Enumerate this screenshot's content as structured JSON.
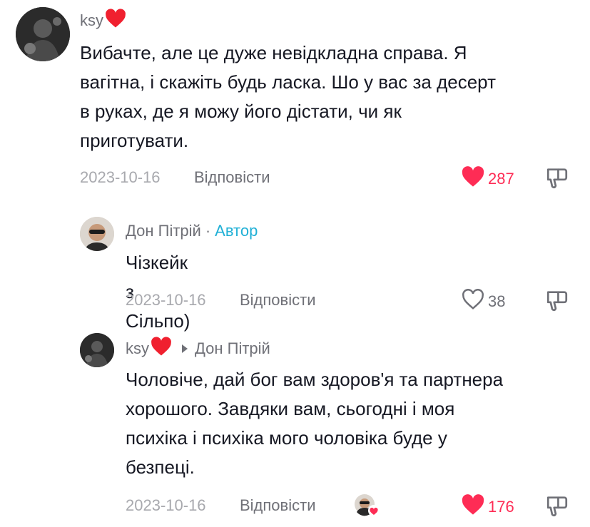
{
  "comments": [
    {
      "author": "ksy",
      "text": "Вибачте, але це дуже невідкладна справа. Я вагітна, і скажіть будь ласка. Шо у вас за десерт в руках, де я можу його дістати, чи як приготувати.",
      "lines": [
        "Вибачте, але це дуже невідкладна справа. Я",
        "вагітна, і скажіть будь ласка. Шо у вас за десерт",
        "в руках, де я можу його дістати, чи як",
        "приготувати."
      ],
      "date": "2023-10-16",
      "reply_label": "Відповісти",
      "likes": "287",
      "liked": true
    },
    {
      "author": "Дон Пітрій",
      "separator": "·",
      "author_tag": "Автор",
      "text": "Чізкейк з Сільпо)",
      "date": "2023-10-16",
      "reply_label": "Відповісти",
      "likes": "38",
      "liked": false
    },
    {
      "author": "ksy",
      "reply_to": "Дон Пітрій",
      "lines": [
        "Чоловіче, дай бог вам здоров'я та партнера",
        "хорошого. Завдяки вам, сьогодні і моя",
        "психіка і психіка мого чоловіка буде у",
        "безпеці."
      ],
      "date": "2023-10-16",
      "reply_label": "Відповісти",
      "likes": "176",
      "liked": true
    }
  ],
  "colors": {
    "like_red": "#fe2c55",
    "author_blue": "#20b0d6",
    "muted": "#6f7077",
    "date_gray": "#a8a9ae"
  },
  "icons": {
    "like": "heart-icon",
    "dislike": "thumbs-down-icon",
    "reply_arrow": "triangle-right-icon",
    "creator_liked": "creator-liked-avatar"
  }
}
